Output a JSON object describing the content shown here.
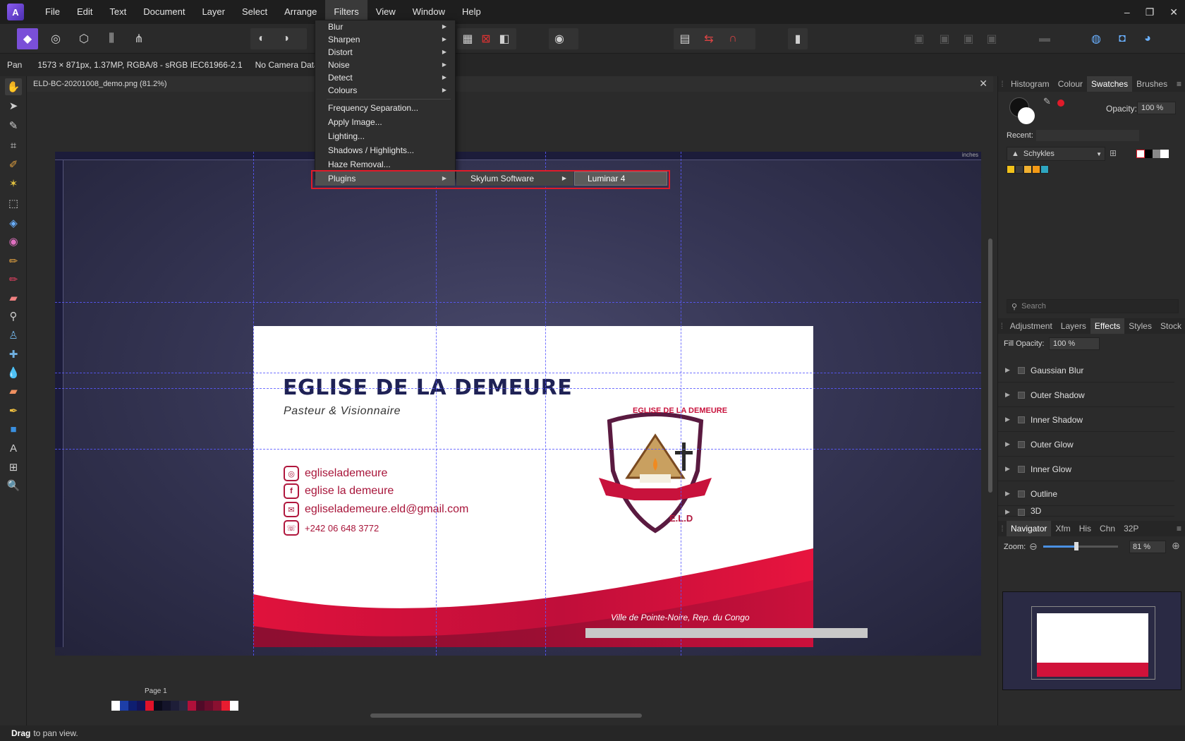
{
  "menubar": {
    "items": [
      "File",
      "Edit",
      "Text",
      "Document",
      "Layer",
      "Select",
      "Arrange",
      "Filters",
      "View",
      "Window",
      "Help"
    ],
    "active": "Filters",
    "window_controls": [
      "–",
      "❐",
      "✕"
    ]
  },
  "contextbar": {
    "tool": "Pan",
    "image_info": "1573 × 871px, 1.37MP, RGBA/8 - sRGB IEC61966-2.1",
    "camera": "No Camera Data"
  },
  "document": {
    "tab_title": "ELD-BC-20201008_demo.png (81.2%)",
    "page_label": "Page 1",
    "ruler_unit": "inches"
  },
  "card": {
    "title": "EGLISE DE LA DEMEURE",
    "subtitle": "Pasteur & Visionnaire",
    "contacts": [
      {
        "icon": "instagram-icon",
        "glyph": "◎",
        "text": "egliselademeure"
      },
      {
        "icon": "facebook-icon",
        "glyph": "f",
        "text": "eglise la demeure"
      },
      {
        "icon": "mail-icon",
        "glyph": "✉",
        "text": "egliselademeure.eld@gmail.com"
      },
      {
        "icon": "phone-icon",
        "glyph": "☏",
        "text": "+242 06 648 3772"
      }
    ],
    "logo_title": "EGLISE DE LA DEMEURE",
    "logo_initials": "E.L.D",
    "city": "Ville de Pointe-Noire, Rep. du Congo"
  },
  "filters_menu": {
    "items": [
      "Blur",
      "Sharpen",
      "Distort",
      "Noise",
      "Detect",
      "Colours"
    ],
    "items2": [
      "Frequency Separation...",
      "Apply Image...",
      "Lighting...",
      "Shadows / Highlights...",
      "Haze Removal..."
    ],
    "plugins": "Plugins",
    "skylum": "Skylum Software",
    "luminar": "Luminar 4"
  },
  "right_panel": {
    "top_tabs": [
      "Histogram",
      "Colour",
      "Swatches",
      "Brushes"
    ],
    "top_active": "Swatches",
    "opacity_label": "Opacity:",
    "opacity_value": "100 %",
    "recent_label": "Recent:",
    "palette_name": "Schykles",
    "swatch_colors": [
      "#f2c21a",
      "#3a3a3a",
      "#f0b030",
      "#f39a16",
      "#2ea6c0"
    ],
    "search_placeholder": "Search",
    "mid_tabs": [
      "Adjustment",
      "Layers",
      "Effects",
      "Styles",
      "Stock"
    ],
    "mid_active": "Effects",
    "fill_opacity_label": "Fill Opacity:",
    "fill_opacity_value": "100 %",
    "effects": [
      "Gaussian Blur",
      "Outer Shadow",
      "Inner Shadow",
      "Outer Glow",
      "Inner Glow",
      "Outline",
      "3D"
    ],
    "nav_tabs": [
      "Navigator",
      "Xfm",
      "His",
      "Chn",
      "32P"
    ],
    "nav_active": "Navigator",
    "zoom_label": "Zoom:",
    "zoom_value": "81 %",
    "zoom_level_percent": 81
  },
  "statusbar": {
    "bold": "Drag",
    "text": "to pan view."
  },
  "colors": {
    "accent_red": "#e01b2a",
    "card_navy": "#1f2255",
    "card_red": "#c8123c"
  }
}
